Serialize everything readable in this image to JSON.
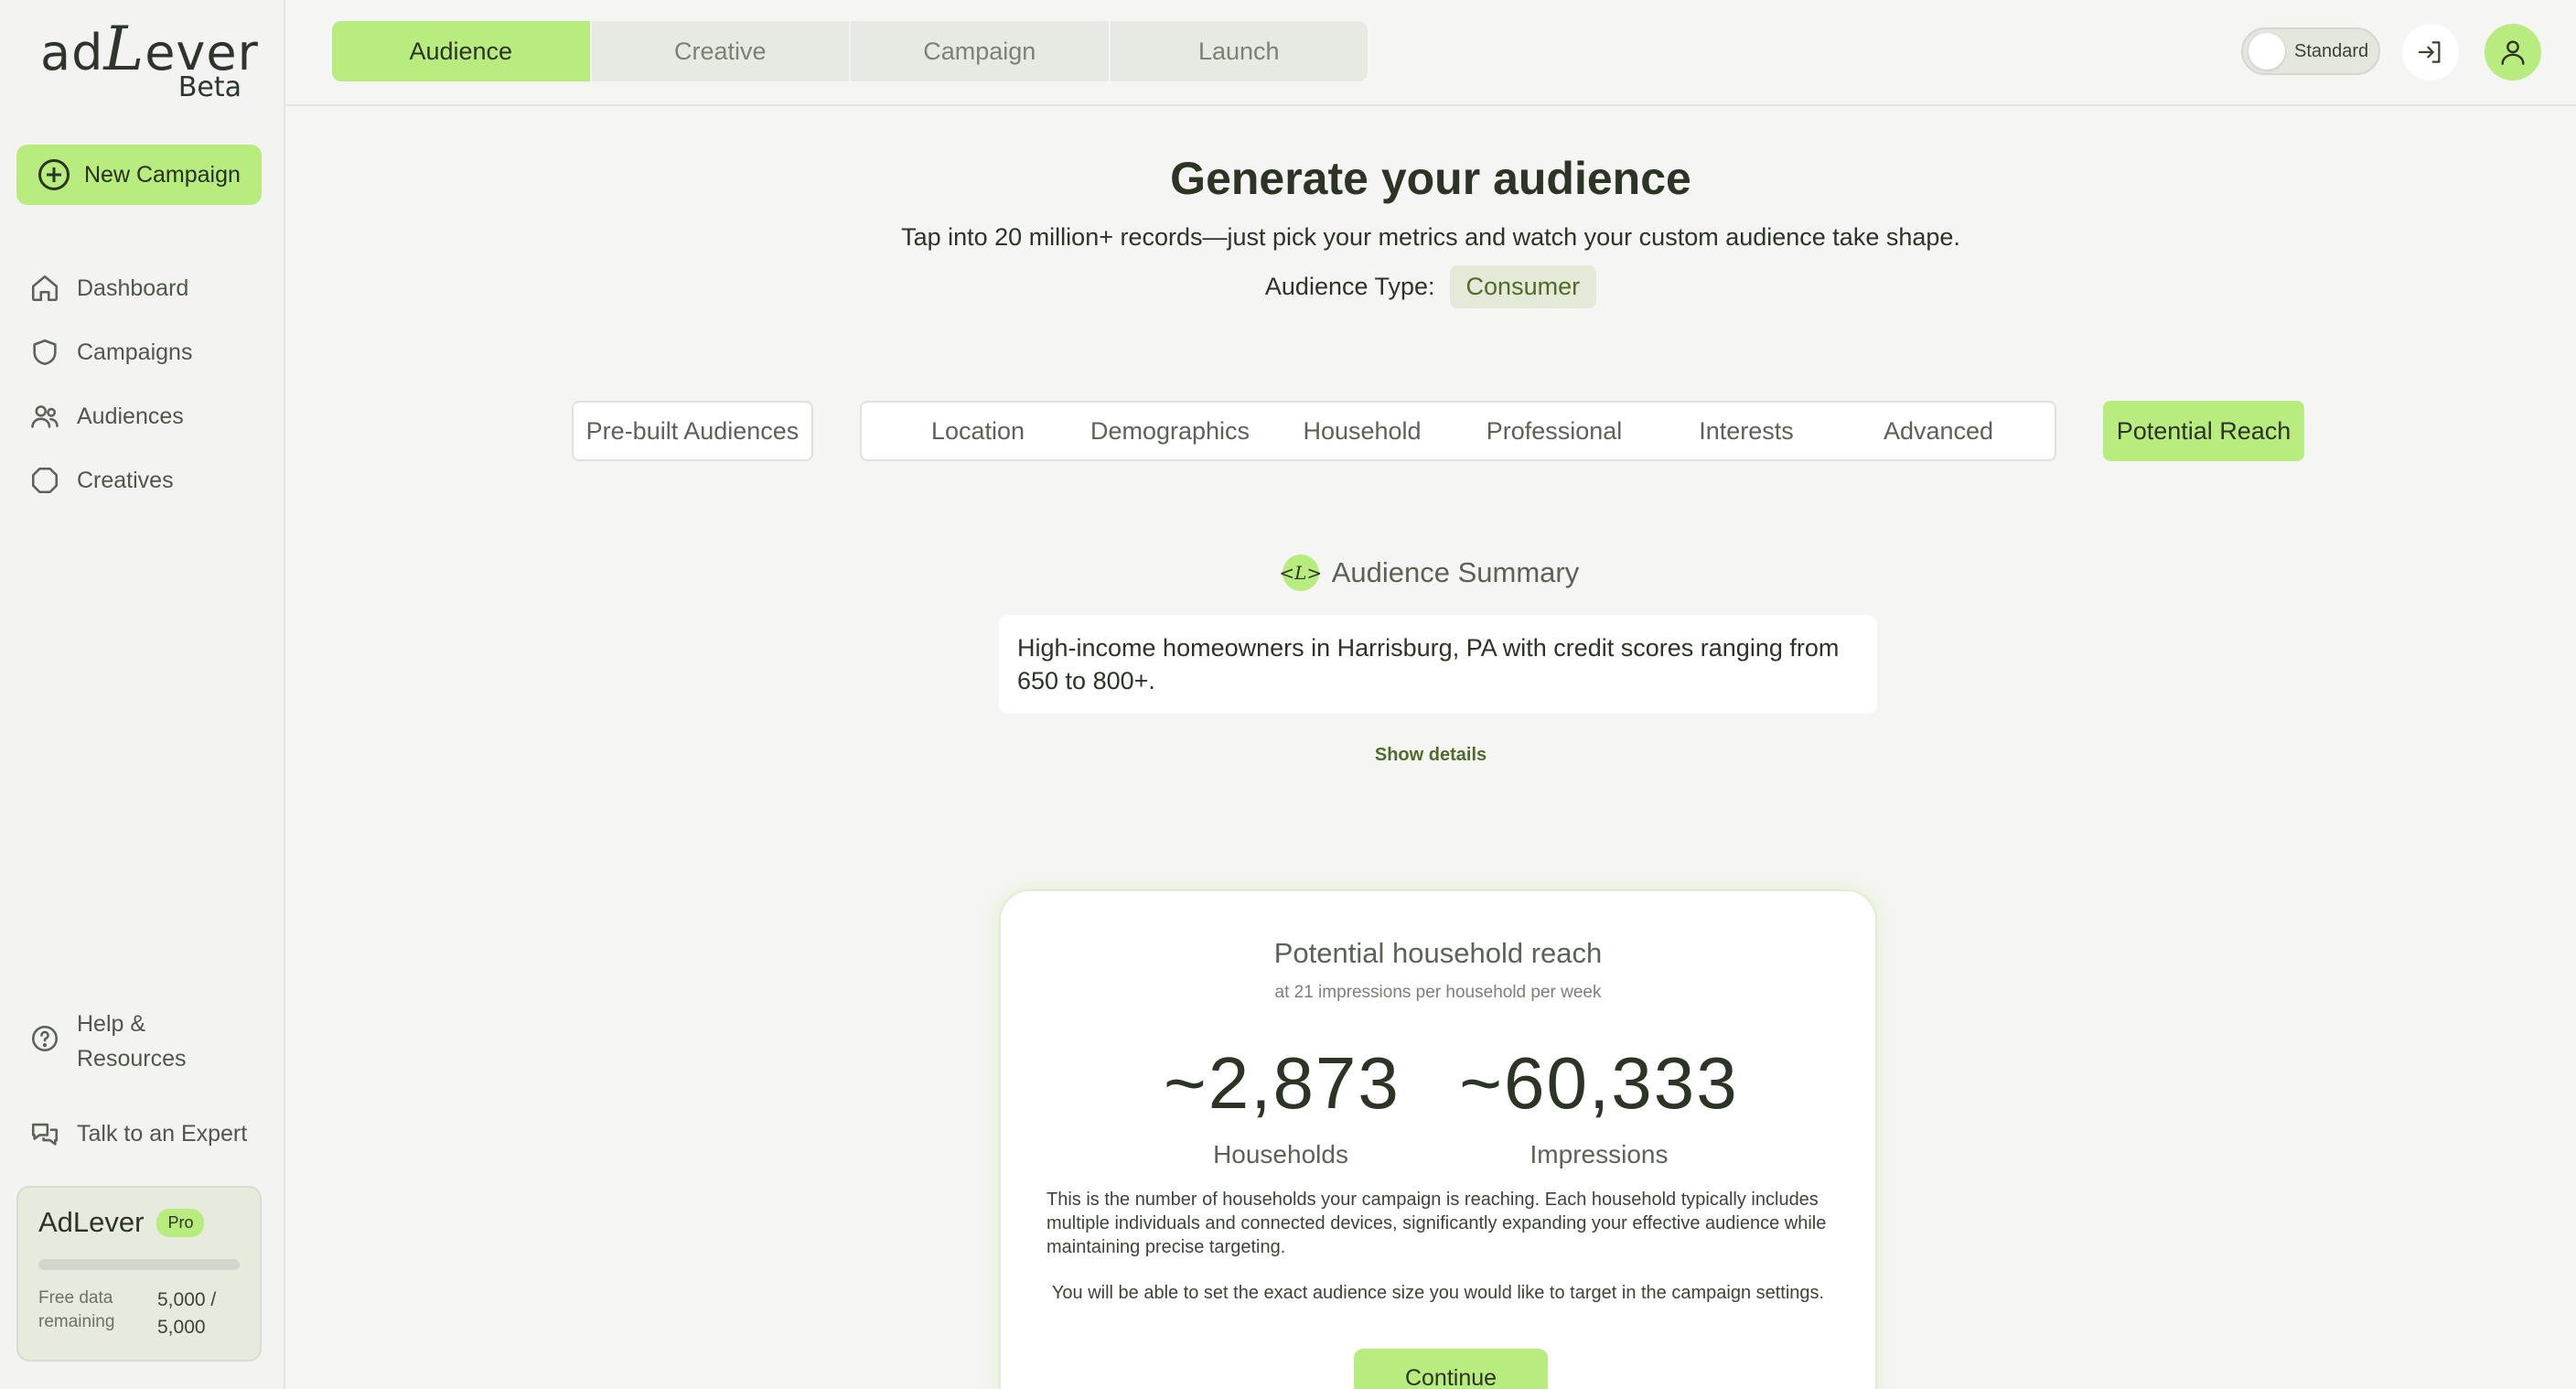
{
  "brand": {
    "logo_prefix": "ad",
    "logo_l": "L",
    "logo_suffix": "ever",
    "beta": "Beta",
    "accent": "#b9ec7e"
  },
  "sidebar": {
    "new_campaign": "New Campaign",
    "items": [
      {
        "label": "Dashboard",
        "icon": "home-icon"
      },
      {
        "label": "Campaigns",
        "icon": "shield-icon"
      },
      {
        "label": "Audiences",
        "icon": "users-icon"
      },
      {
        "label": "Creatives",
        "icon": "octagon-icon"
      }
    ],
    "help": "Help & Resources",
    "talk": "Talk to an Expert",
    "plan": {
      "name": "AdLever",
      "badge": "Pro",
      "data_label": "Free data remaining",
      "data_value": "5,000 / 5,000",
      "usage_fraction": 0
    }
  },
  "header": {
    "steps": [
      "Audience",
      "Creative",
      "Campaign",
      "Launch"
    ],
    "active_step": "Audience",
    "mode_toggle": "Standard"
  },
  "main": {
    "title": "Generate your audience",
    "subtitle": "Tap into 20 million+ records—just pick your metrics and watch your custom audience take shape.",
    "audience_type_label": "Audience Type:",
    "audience_type_value": "Consumer",
    "prebuilt": "Pre-built Audiences",
    "tabs": [
      "Location",
      "Demographics",
      "Household",
      "Professional",
      "Interests",
      "Advanced"
    ],
    "reach_tab": "Potential Reach",
    "summary_title": "Audience Summary",
    "summary_badge": "<L>",
    "summary_text": "High-income homeowners in Harrisburg, PA with credit scores ranging from 650 to 800+.",
    "show_details": "Show details",
    "reach": {
      "title": "Potential household reach",
      "subtitle": "at 21 impressions per household per week",
      "households_value": "~2,873",
      "households_label": "Households",
      "impressions_value": "~60,333",
      "impressions_label": "Impressions",
      "description": "This is the number of households your campaign is reaching. Each household typically includes multiple individuals and connected devices, significantly expanding your effective audience while maintaining precise targeting.",
      "note": "You will be able to set the exact audience size you would like to target in the campaign settings.",
      "continue": "Continue"
    }
  }
}
